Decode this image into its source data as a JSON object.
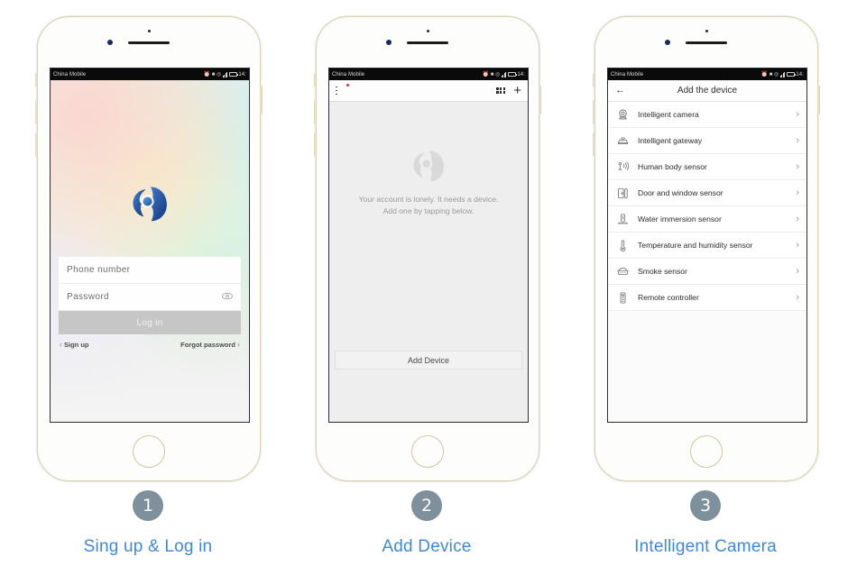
{
  "statusbar": {
    "carrier": "China Mobile",
    "time": "14:",
    "icons": [
      "alarm-icon",
      "sdcard-icon",
      "wifi-icon",
      "signal-icon",
      "battery-icon"
    ]
  },
  "phone1": {
    "screen_name": "Login screen",
    "logo_alt": "app-logo",
    "phone_field": {
      "placeholder": "Phone  number",
      "value": ""
    },
    "password_field": {
      "placeholder": "Password",
      "value": "",
      "reveal_icon": "eye-icon"
    },
    "login_button": "Log in",
    "sign_up": "Sign up",
    "forgot_password": "Forgot password",
    "login_button_color": "#c6c6c6"
  },
  "phone2": {
    "screen_name": "Device list empty state",
    "toolbar": {
      "list_icon": "list-icon",
      "badge": true,
      "grid_icon": "grid-icon",
      "plus_icon": "plus-icon"
    },
    "empty_logo": "app-logo-grey",
    "empty_text_line1": "Your account is lonely. It needs a device.",
    "empty_text_line2": "Add one by tapping below.",
    "add_device_button": "Add Device"
  },
  "phone3": {
    "screen_name": "Add the device",
    "back_icon": "back-arrow-icon",
    "title": "Add the device",
    "devices": [
      {
        "label": "Intelligent camera",
        "icon": "camera-icon"
      },
      {
        "label": "Intelligent gateway",
        "icon": "gateway-icon"
      },
      {
        "label": "Human body sensor",
        "icon": "motion-sensor-icon"
      },
      {
        "label": "Door and window sensor",
        "icon": "door-sensor-icon"
      },
      {
        "label": "Water immersion sensor",
        "icon": "water-sensor-icon"
      },
      {
        "label": "Temperature and humidity sensor",
        "icon": "thermometer-icon"
      },
      {
        "label": "Smoke sensor",
        "icon": "smoke-sensor-icon"
      },
      {
        "label": "Remote controller",
        "icon": "remote-icon"
      }
    ],
    "chevron": "chevron-right-icon"
  },
  "steps": [
    {
      "number": "1",
      "label": "Sing up & Log in"
    },
    {
      "number": "2",
      "label": "Add Device"
    },
    {
      "number": "3",
      "label": "Intelligent Camera"
    }
  ],
  "colors": {
    "accent": "#3c8ae0",
    "step_circle": "#7d909c",
    "badge": "#e03030",
    "frame": "#d8d2b8"
  }
}
